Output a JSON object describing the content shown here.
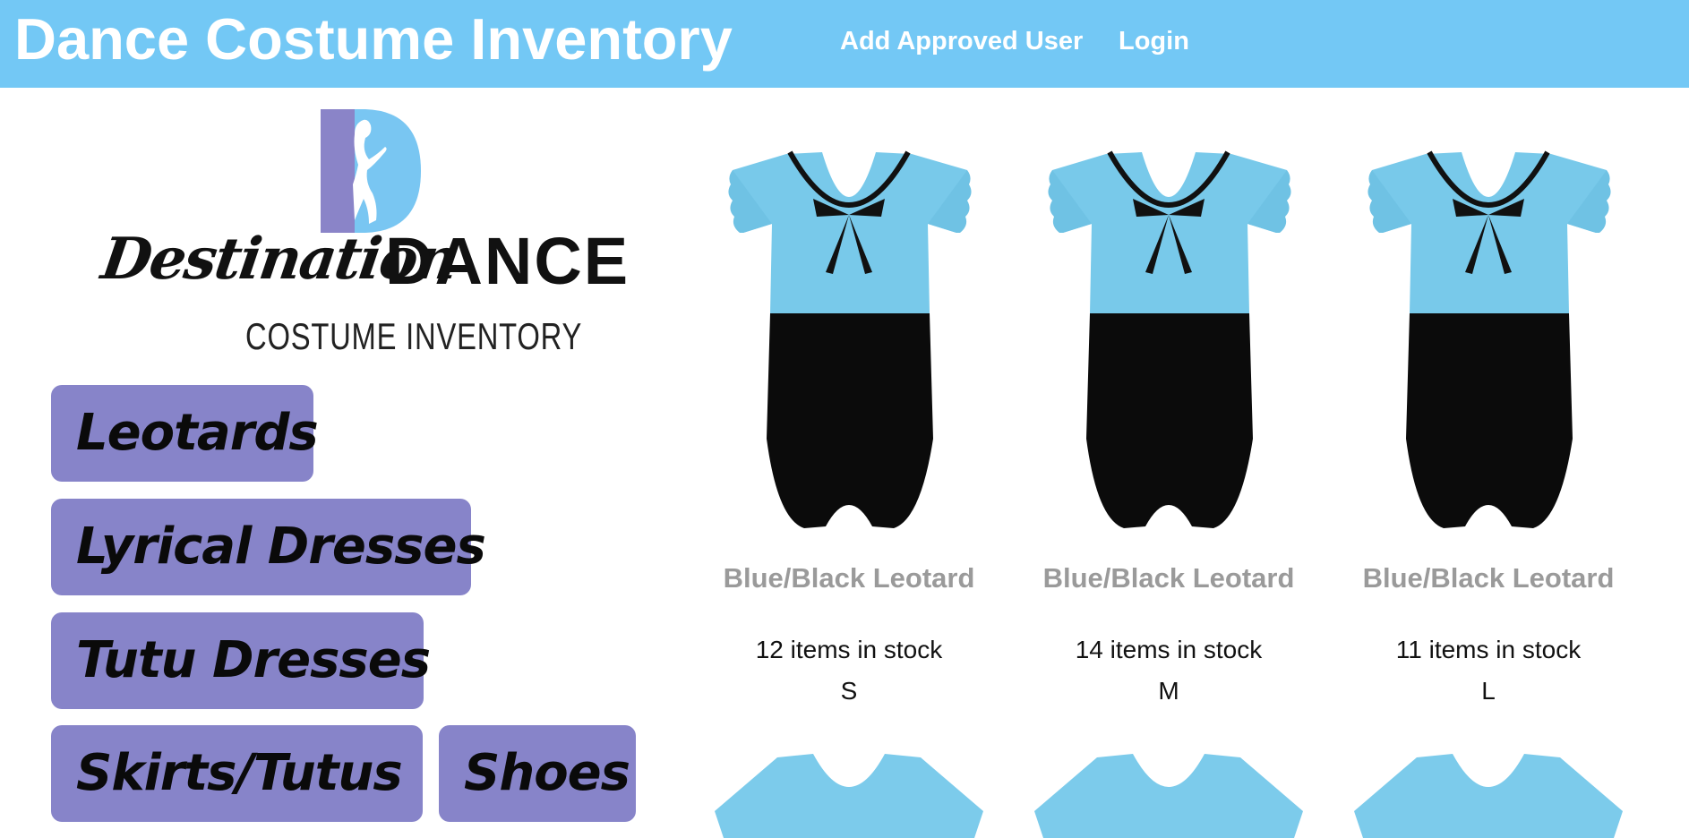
{
  "header": {
    "title": "Dance Costume Inventory",
    "nav": {
      "add_user": "Add Approved User",
      "login": "Login"
    },
    "background_color": "#73c8f5"
  },
  "logo": {
    "script_text": "Destination",
    "bold_text": "DANCE",
    "subtitle": "COSTUME INVENTORY"
  },
  "categories": {
    "leotards": "Leotards",
    "lyrical": "Lyrical Dresses",
    "tutu_dresses": "Tutu Dresses",
    "skirts": "Skirts/Tutus",
    "shoes": "Shoes",
    "button_color": "#8784c9"
  },
  "products": [
    {
      "name": "Blue/Black Leotard",
      "stock": "12 items in stock",
      "size": "S"
    },
    {
      "name": "Blue/Black Leotard",
      "stock": "14 items in stock",
      "size": "M"
    },
    {
      "name": "Blue/Black Leotard",
      "stock": "11 items in stock",
      "size": "L"
    }
  ]
}
